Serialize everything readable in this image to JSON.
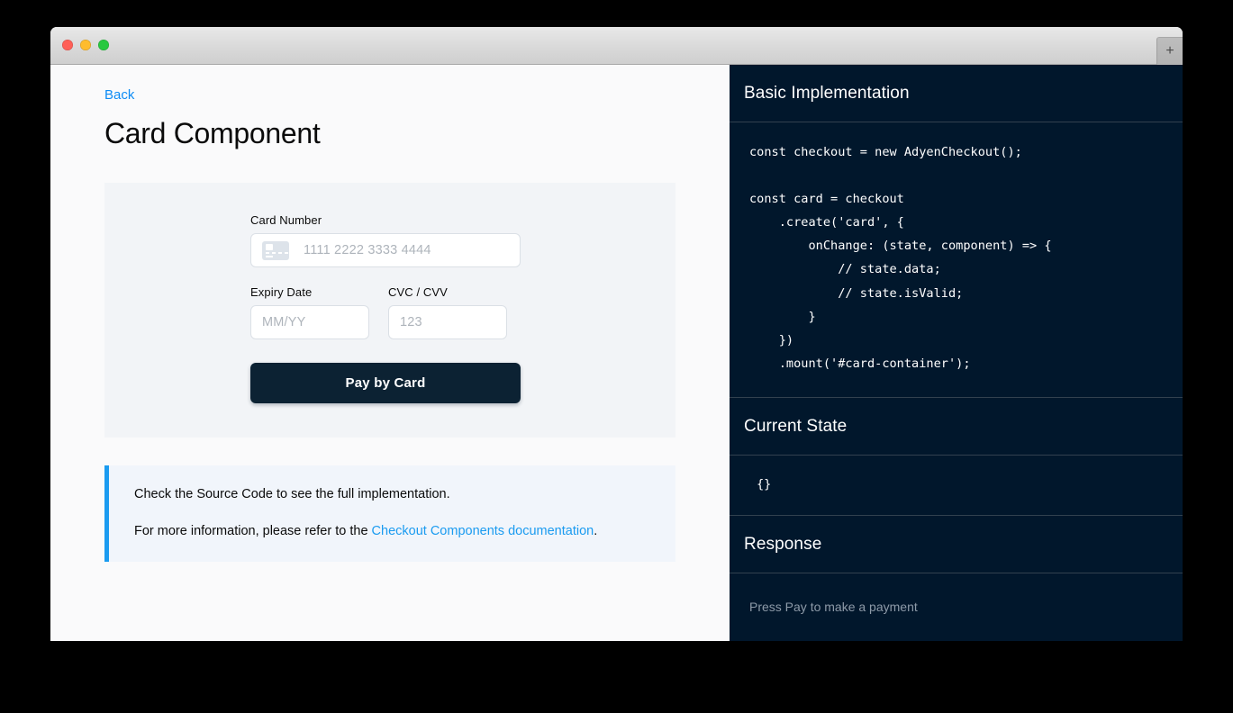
{
  "window": {
    "traffic_lights": [
      "close-red",
      "minimize-yellow",
      "maximize-green"
    ],
    "new_tab_label": "+",
    "colors": {
      "page_bg": "#fafafb",
      "panel_bg": "#f2f4f7",
      "dark_panel": "#01172c",
      "accent_blue": "#1a9bf0",
      "link_blue": "#0d8cf5",
      "button_navy": "#0c2233",
      "divider": "#32414f"
    }
  },
  "left": {
    "back_label": "Back",
    "page_title": "Card Component",
    "form": {
      "card_number": {
        "label": "Card Number",
        "placeholder": "1111 2222 3333 4444",
        "value": "",
        "brand_icon": "generic-card-icon"
      },
      "expiry": {
        "label": "Expiry Date",
        "placeholder": "MM/YY",
        "value": ""
      },
      "cvc": {
        "label": "CVC / CVV",
        "placeholder": "123",
        "value": ""
      },
      "submit_label": "Pay by Card"
    },
    "info": {
      "line1": "Check the Source Code to see the full implementation.",
      "line2_prefix": "For more information, please refer to the ",
      "line2_link": "Checkout Components documentation",
      "line2_suffix": "."
    }
  },
  "right": {
    "sections": [
      {
        "title": "Basic Implementation",
        "code": "const checkout = new AdyenCheckout();\n\nconst card = checkout\n    .create('card', {\n        onChange: (state, component) => {\n            // state.data;\n            // state.isValid;\n        }\n    })\n    .mount('#card-container');"
      },
      {
        "title": "Current State",
        "code": "{}"
      },
      {
        "title": "Response",
        "placeholder_text": "Press Pay to make a payment"
      }
    ]
  }
}
